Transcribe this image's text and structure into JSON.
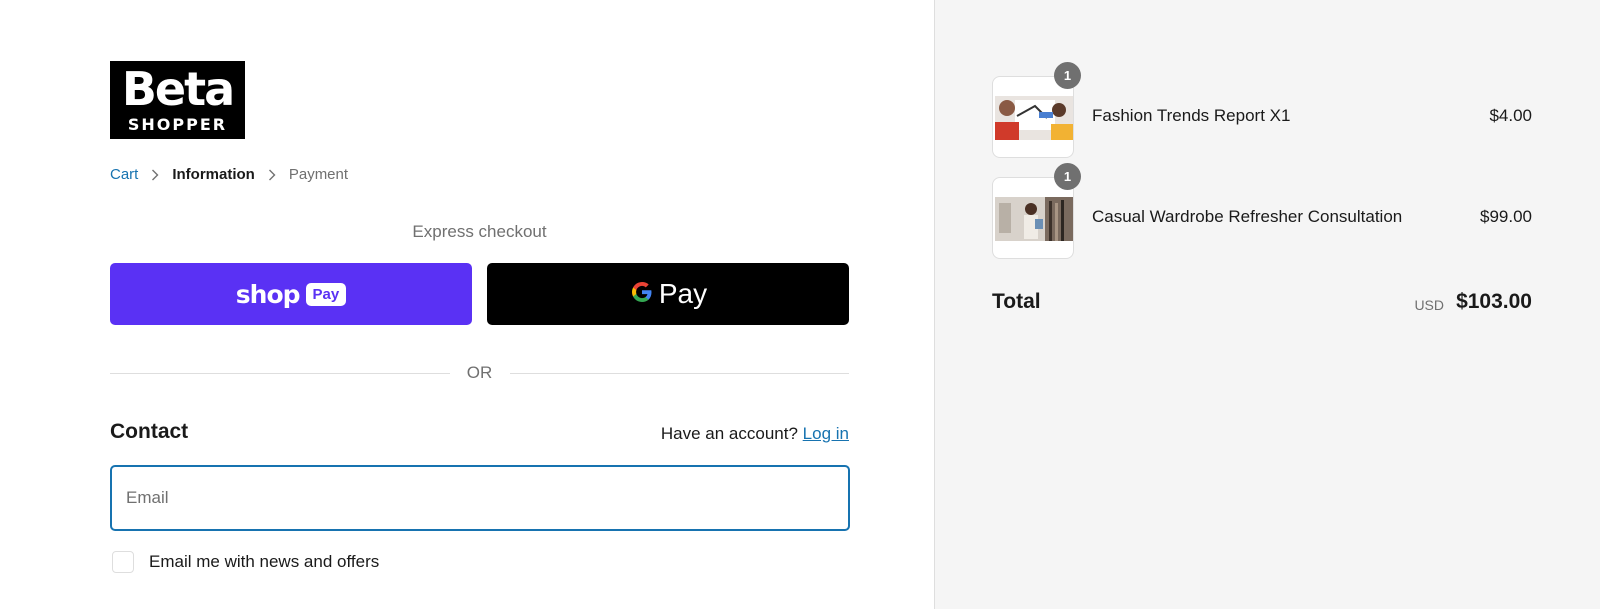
{
  "brand": {
    "logo_top": "Beta",
    "logo_bottom": "SHOPPER"
  },
  "breadcrumb": {
    "items": [
      "Cart",
      "Information",
      "Payment"
    ]
  },
  "express": {
    "label": "Express checkout",
    "shop_pay": {
      "word": "shop",
      "pill": "Pay",
      "color": "#5a31f4"
    },
    "google_pay": {
      "text": "Pay",
      "color": "#000000"
    }
  },
  "divider": {
    "text": "OR"
  },
  "contact": {
    "title": "Contact",
    "account_prompt": "Have an account?",
    "login_label": "Log in",
    "email_placeholder": "Email",
    "newsletter_label": "Email me with news and offers"
  },
  "summary": {
    "items": [
      {
        "name": "Fashion Trends Report X1",
        "price": "$4.00",
        "quantity": "1"
      },
      {
        "name": "Casual Wardrobe Refresher Consultation",
        "price": "$99.00",
        "quantity": "1"
      }
    ],
    "total_label": "Total",
    "currency": "USD",
    "total": "$103.00"
  },
  "colors": {
    "accent": "#1773b0",
    "summary_bg": "#f5f5f5",
    "badge": "#707070"
  }
}
